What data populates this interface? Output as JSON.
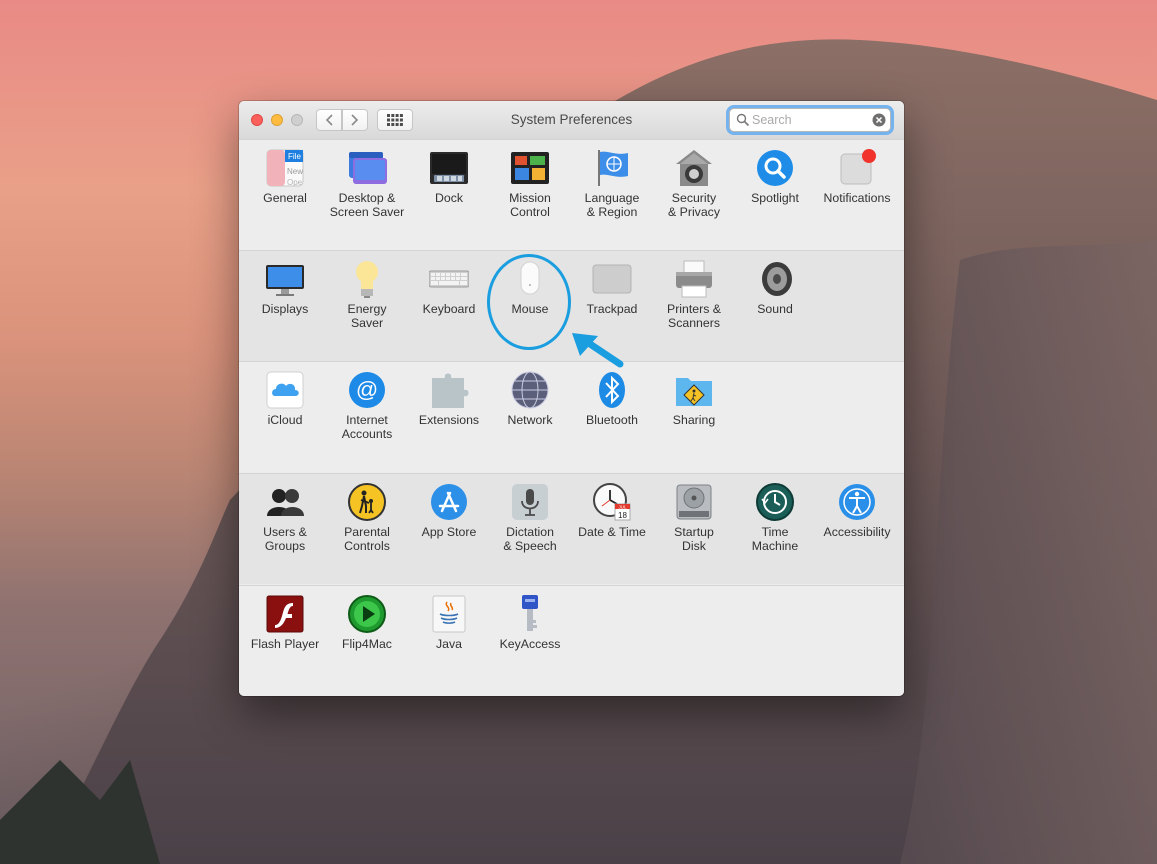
{
  "window": {
    "title": "System Preferences",
    "search_placeholder": "Search"
  },
  "sections": [
    {
      "items": [
        {
          "label": "General",
          "icon": "general-icon"
        },
        {
          "label": "Desktop &\nScreen Saver",
          "icon": "desktop-screensaver-icon"
        },
        {
          "label": "Dock",
          "icon": "dock-icon"
        },
        {
          "label": "Mission\nControl",
          "icon": "mission-control-icon"
        },
        {
          "label": "Language\n& Region",
          "icon": "language-region-icon"
        },
        {
          "label": "Security\n& Privacy",
          "icon": "security-privacy-icon"
        },
        {
          "label": "Spotlight",
          "icon": "spotlight-icon"
        },
        {
          "label": "Notifications",
          "icon": "notifications-icon"
        }
      ]
    },
    {
      "items": [
        {
          "label": "Displays",
          "icon": "displays-icon"
        },
        {
          "label": "Energy\nSaver",
          "icon": "energy-saver-icon"
        },
        {
          "label": "Keyboard",
          "icon": "keyboard-icon"
        },
        {
          "label": "Mouse",
          "icon": "mouse-icon"
        },
        {
          "label": "Trackpad",
          "icon": "trackpad-icon"
        },
        {
          "label": "Printers &\nScanners",
          "icon": "printers-scanners-icon"
        },
        {
          "label": "Sound",
          "icon": "sound-icon"
        }
      ]
    },
    {
      "items": [
        {
          "label": "iCloud",
          "icon": "icloud-icon"
        },
        {
          "label": "Internet\nAccounts",
          "icon": "internet-accounts-icon"
        },
        {
          "label": "Extensions",
          "icon": "extensions-icon"
        },
        {
          "label": "Network",
          "icon": "network-icon"
        },
        {
          "label": "Bluetooth",
          "icon": "bluetooth-icon"
        },
        {
          "label": "Sharing",
          "icon": "sharing-icon"
        }
      ]
    },
    {
      "items": [
        {
          "label": "Users &\nGroups",
          "icon": "users-groups-icon"
        },
        {
          "label": "Parental\nControls",
          "icon": "parental-controls-icon"
        },
        {
          "label": "App Store",
          "icon": "app-store-icon"
        },
        {
          "label": "Dictation\n& Speech",
          "icon": "dictation-speech-icon"
        },
        {
          "label": "Date & Time",
          "icon": "date-time-icon"
        },
        {
          "label": "Startup\nDisk",
          "icon": "startup-disk-icon"
        },
        {
          "label": "Time\nMachine",
          "icon": "time-machine-icon"
        },
        {
          "label": "Accessibility",
          "icon": "accessibility-icon"
        }
      ]
    },
    {
      "items": [
        {
          "label": "Flash Player",
          "icon": "flash-player-icon"
        },
        {
          "label": "Flip4Mac",
          "icon": "flip4mac-icon"
        },
        {
          "label": "Java",
          "icon": "java-icon"
        },
        {
          "label": "KeyAccess",
          "icon": "keyaccess-icon"
        }
      ]
    }
  ],
  "icon_text": {
    "general_file": "File",
    "general_new": "New",
    "general_open": "Ope",
    "calendar_month": "JUL",
    "calendar_day": "18"
  },
  "colors": {
    "highlight": "#1a9ee0",
    "search_focus": "#75b3ee"
  }
}
